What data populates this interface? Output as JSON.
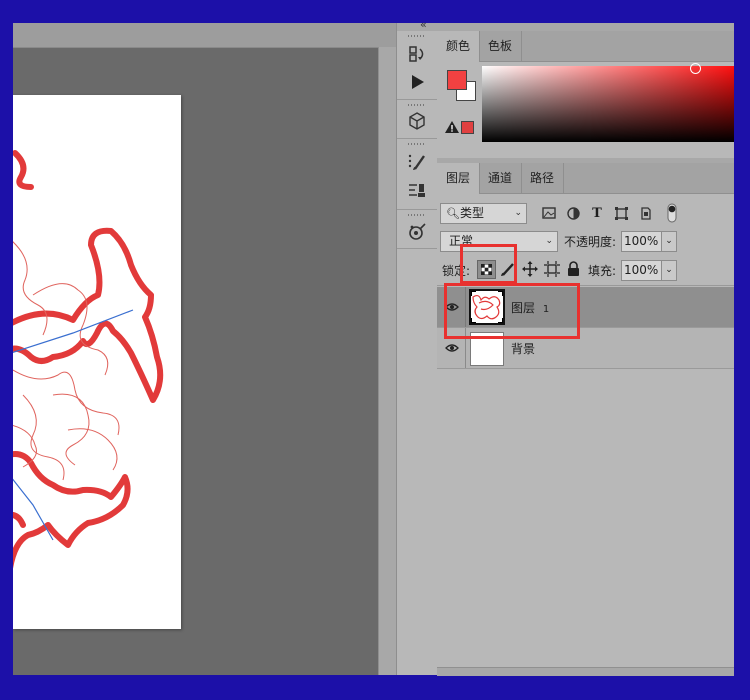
{
  "color_panel": {
    "tabs": [
      "颜色",
      "色板"
    ],
    "active_tab": 0,
    "foreground_color": "#f24141",
    "background_color": "#ffffff",
    "gamut_warning_color": "#e04040"
  },
  "layers_panel": {
    "tabs": [
      "图层",
      "通道",
      "路径"
    ],
    "active_tab": 0,
    "filter_kind_label": "类型",
    "blend_mode": "正常",
    "opacity_label": "不透明度:",
    "opacity_value": "100%",
    "lock_label": "锁定:",
    "fill_label": "填充:",
    "fill_value": "100%",
    "layers": [
      {
        "name": "图层",
        "suffix": "1",
        "selected": true
      },
      {
        "name": "背景",
        "suffix": "",
        "selected": false
      }
    ]
  },
  "tool_strip": {
    "collapse_glyph": "«",
    "tools": [
      "history-icon",
      "play-action-icon",
      "3d-cube-icon",
      "brush-presets-icon",
      "clone-source-icon",
      "properties-icon"
    ]
  },
  "colors": {
    "frame": "#1c10a8",
    "panel": "#b8b8b8",
    "highlight": "#e8312f",
    "stroke_red": "#e23a3a",
    "guide_blue": "#3a6fd0"
  }
}
